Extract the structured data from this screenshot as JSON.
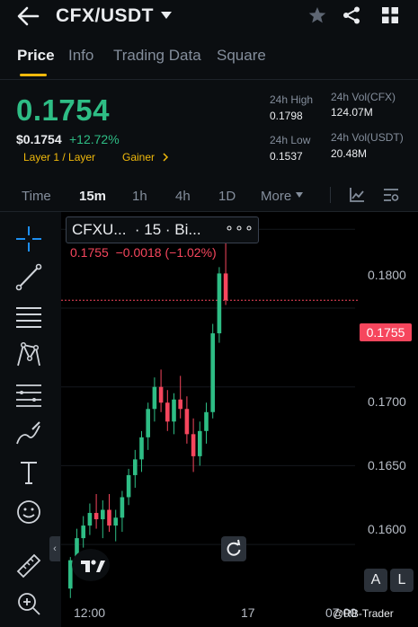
{
  "header": {
    "pair": "CFX/USDT"
  },
  "tabs": [
    {
      "label": "Price",
      "active": true
    },
    {
      "label": "Info",
      "active": false
    },
    {
      "label": "Trading Data",
      "active": false
    },
    {
      "label": "Square",
      "active": false
    }
  ],
  "ticker": {
    "last_price": "0.1754",
    "usd_price": "$0.1754",
    "change_pct": "+12.72%",
    "tag_category": "Layer 1 / Layer",
    "tag_gainer": "Gainer",
    "high_label": "24h High",
    "high_value": "0.1798",
    "low_label": "24h Low",
    "low_value": "0.1537",
    "vol_cfx_label": "24h Vol(CFX)",
    "vol_cfx_value": "124.07M",
    "vol_usdt_label": "24h Vol(USDT)",
    "vol_usdt_value": "20.48M"
  },
  "intervals": [
    {
      "label": "Time",
      "active": false
    },
    {
      "label": "15m",
      "active": true
    },
    {
      "label": "1h",
      "active": false
    },
    {
      "label": "4h",
      "active": false
    },
    {
      "label": "1D",
      "active": false
    },
    {
      "label": "More",
      "active": false
    }
  ],
  "chart_legend": {
    "title": "CFXU...  · 15 · Bi...",
    "dots": "∘∘∘",
    "ohlc": "0.1755  −0.0018 (−1.02%)"
  },
  "current_price_tag": "0.1755",
  "chart_buttons": {
    "auto": "A",
    "log": "L"
  },
  "watermark": "@RB-Trader",
  "colors": {
    "up": "#2ebd85",
    "down": "#f6465d",
    "accent": "#f0b90b",
    "background": "#0b0e11"
  },
  "chart_data": {
    "type": "candlestick",
    "title": "",
    "ylim": [
      0.1567,
      0.1811
    ],
    "y_ticks": [
      "0.1800",
      "0.1750",
      "0.1700",
      "0.1650",
      "0.1600"
    ],
    "y_tick_values": [
      0.18,
      0.175,
      0.17,
      0.165,
      0.16
    ],
    "x_ticks": [
      "12:00",
      "17",
      "07:00"
    ],
    "x_tick_index": [
      1.5,
      19.5,
      32.5
    ],
    "current_price": 0.1755,
    "candles": [
      {
        "o": 0.1572,
        "h": 0.1592,
        "l": 0.1566,
        "c": 0.159
      },
      {
        "o": 0.159,
        "h": 0.161,
        "l": 0.1583,
        "c": 0.1604
      },
      {
        "o": 0.1604,
        "h": 0.1618,
        "l": 0.1598,
        "c": 0.1612
      },
      {
        "o": 0.1612,
        "h": 0.1626,
        "l": 0.1606,
        "c": 0.162
      },
      {
        "o": 0.162,
        "h": 0.1632,
        "l": 0.161,
        "c": 0.1616
      },
      {
        "o": 0.1616,
        "h": 0.1628,
        "l": 0.1604,
        "c": 0.1622
      },
      {
        "o": 0.1622,
        "h": 0.1632,
        "l": 0.1608,
        "c": 0.1612
      },
      {
        "o": 0.1612,
        "h": 0.1622,
        "l": 0.1602,
        "c": 0.1617
      },
      {
        "o": 0.1617,
        "h": 0.1634,
        "l": 0.1608,
        "c": 0.163
      },
      {
        "o": 0.163,
        "h": 0.1648,
        "l": 0.1625,
        "c": 0.1644
      },
      {
        "o": 0.1644,
        "h": 0.166,
        "l": 0.1636,
        "c": 0.1654
      },
      {
        "o": 0.1654,
        "h": 0.1672,
        "l": 0.1646,
        "c": 0.1668
      },
      {
        "o": 0.1668,
        "h": 0.169,
        "l": 0.166,
        "c": 0.1686
      },
      {
        "o": 0.1686,
        "h": 0.1706,
        "l": 0.1678,
        "c": 0.17
      },
      {
        "o": 0.17,
        "h": 0.1711,
        "l": 0.1684,
        "c": 0.169
      },
      {
        "o": 0.169,
        "h": 0.1698,
        "l": 0.1672,
        "c": 0.1678
      },
      {
        "o": 0.1678,
        "h": 0.1696,
        "l": 0.167,
        "c": 0.1692
      },
      {
        "o": 0.1692,
        "h": 0.1707,
        "l": 0.168,
        "c": 0.1686
      },
      {
        "o": 0.1686,
        "h": 0.1694,
        "l": 0.1664,
        "c": 0.167
      },
      {
        "o": 0.167,
        "h": 0.168,
        "l": 0.1646,
        "c": 0.1656
      },
      {
        "o": 0.1656,
        "h": 0.1678,
        "l": 0.165,
        "c": 0.1672
      },
      {
        "o": 0.1672,
        "h": 0.169,
        "l": 0.1664,
        "c": 0.1684
      },
      {
        "o": 0.1684,
        "h": 0.174,
        "l": 0.168,
        "c": 0.1734
      },
      {
        "o": 0.1734,
        "h": 0.1776,
        "l": 0.1728,
        "c": 0.1772
      },
      {
        "o": 0.1772,
        "h": 0.1798,
        "l": 0.1752,
        "c": 0.1755
      }
    ]
  }
}
